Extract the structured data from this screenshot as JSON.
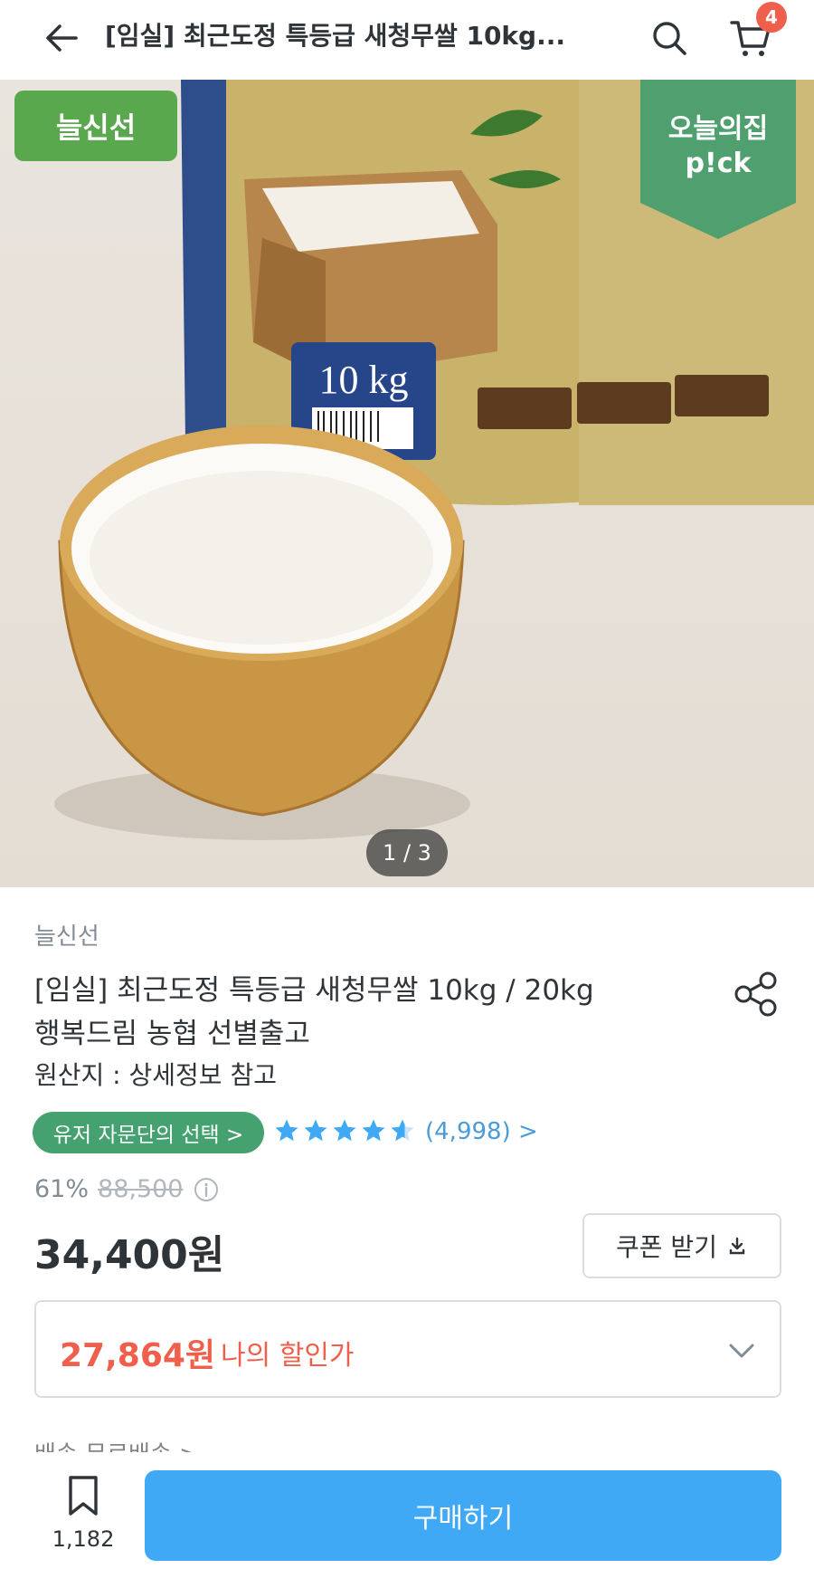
{
  "header": {
    "title": "[임실] 최근도정 특등급 새청무쌀 10kg...",
    "cart_count": "4"
  },
  "hero": {
    "seller_label": "늘신선",
    "pick_line1": "오늘의집",
    "pick_line2": "p!ck",
    "counter": "1 / 3"
  },
  "product": {
    "brand": "늘신선",
    "name_line1": "[임실] 최근도정 특등급 새청무쌀 10kg / 20kg",
    "name_line2": "행복드림 농협 선별출고",
    "origin": "원산지 : 상세정보 참고",
    "advisor_badge": "유저 자문단의 선택 >",
    "rating_stars": 4.5,
    "review_count": "(4,998) >",
    "discount_rate": "61%",
    "original_price": "88,500",
    "price": "34,400원",
    "coupon_button": "쿠폰 받기",
    "my_price": "27,864원",
    "my_price_label": "나의 할인가",
    "shipping_peek": "배송     무료배송 >"
  },
  "bottom_bar": {
    "bookmark_count": "1,182",
    "buy_button": "구매하기"
  },
  "colors": {
    "accent": "#3fa9f5",
    "seller_green": "#5aa84d",
    "advisor_green": "#45a16f",
    "pick_green": "#4f9f6f",
    "star_blue": "#3fa9f5",
    "discount_red": "#ef5f4b"
  }
}
